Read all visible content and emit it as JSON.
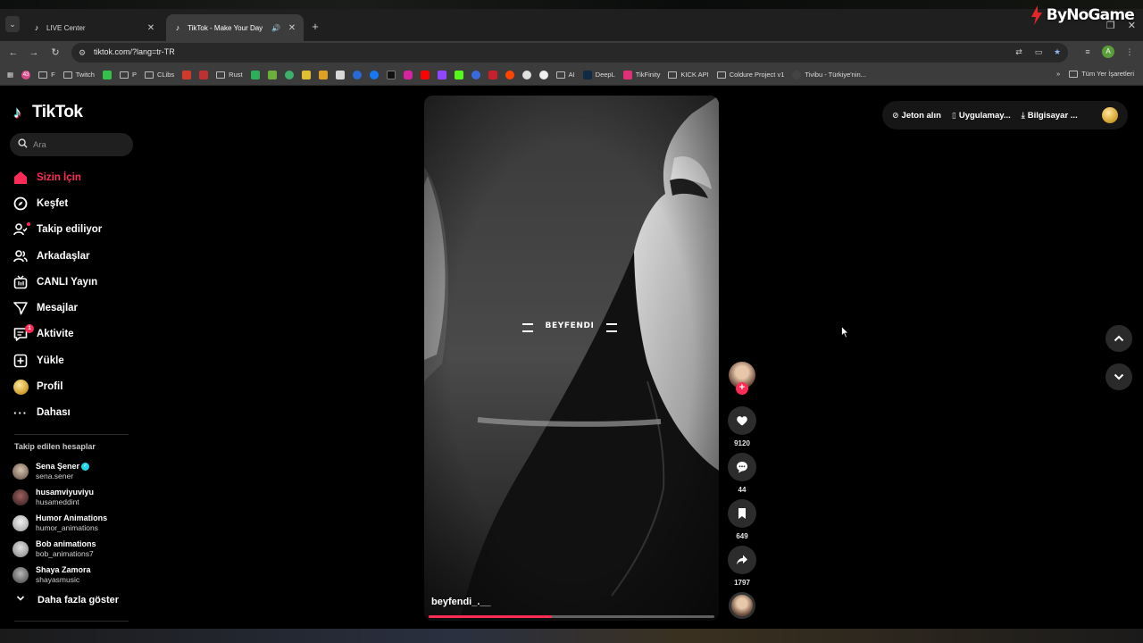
{
  "browser": {
    "tabs": [
      {
        "title": "LIVE Center",
        "active": false
      },
      {
        "title": "TikTok - Make Your Day",
        "active": true
      }
    ],
    "url": "tiktok.com/?lang=tr-TR",
    "profile_initial": "A",
    "bookmarks": [
      "F",
      "Twitch",
      "P",
      "CLibs",
      "Rust",
      "DeepL",
      "TikFinity",
      "KICK API",
      "Coldure Project v1",
      "Tivibu - Türkiye'nin..."
    ],
    "all_bookmarks_label": "Tüm Yer İşaretleri",
    "badge_count": "43"
  },
  "watermark": "ByNoGame",
  "tiktok": {
    "logo": "TikTok",
    "search_placeholder": "Ara",
    "nav": [
      {
        "label": "Sizin İçin",
        "icon": "home-icon",
        "active": true
      },
      {
        "label": "Keşfet",
        "icon": "compass-icon"
      },
      {
        "label": "Takip ediliyor",
        "icon": "following-icon"
      },
      {
        "label": "Arkadaşlar",
        "icon": "friends-icon"
      },
      {
        "label": "CANLI Yayın",
        "icon": "live-icon"
      },
      {
        "label": "Mesajlar",
        "icon": "messages-icon"
      },
      {
        "label": "Aktivite",
        "icon": "activity-icon",
        "badge": "1"
      },
      {
        "label": "Yükle",
        "icon": "upload-icon"
      },
      {
        "label": "Profil",
        "icon": "profile-icon"
      },
      {
        "label": "Dahası",
        "icon": "more-icon"
      }
    ],
    "following_title": "Takip edilen hesaplar",
    "following": [
      {
        "name": "Sena Şener",
        "username": "sena.sener",
        "verified": true
      },
      {
        "name": "husamviyuviyu",
        "username": "husameddint"
      },
      {
        "name": "Humor Animations",
        "username": "humor_animations"
      },
      {
        "name": "Bob animations",
        "username": "bob_animations7"
      },
      {
        "name": "Shaya  Zamora",
        "username": "shayasmusic"
      }
    ],
    "show_more": "Daha fazla göster",
    "video": {
      "overlay_title": "BEYFENDI",
      "author": "beyfendi_.__",
      "progress": 0.43,
      "likes": "9120",
      "comments": "44",
      "saves": "649",
      "shares": "1797"
    },
    "topbar": {
      "coins": "Jeton alın",
      "app": "Uygulamay...",
      "desktop": "Bilgisayar ..."
    }
  }
}
